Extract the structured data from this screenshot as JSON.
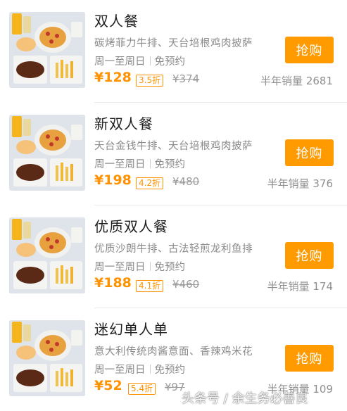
{
  "deals": [
    {
      "title": "双人餐",
      "desc": "碳烤菲力牛排、天台培根鸡肉披萨",
      "days": "周一至周日",
      "booking": "免预约",
      "price": "¥128",
      "discount": "3.5折",
      "original": "¥374",
      "sales": "半年销量 2681",
      "button": "抢购"
    },
    {
      "title": "新双人餐",
      "desc": "天台金钱牛排、天台培根鸡肉披萨",
      "days": "周一至周日",
      "booking": "免预约",
      "price": "¥198",
      "discount": "4.2折",
      "original": "¥480",
      "sales": "半年销量 376",
      "button": "抢购"
    },
    {
      "title": "优质双人餐",
      "desc": "优质沙朗牛排、古法轻煎龙利鱼排",
      "days": "周一至周日",
      "booking": "免预约",
      "price": "¥188",
      "discount": "4.1折",
      "original": "¥460",
      "sales": "半年销量 174",
      "button": "抢购"
    },
    {
      "title": "迷幻单人单",
      "desc": "意大利传统肉酱意面、香辣鸡米花",
      "days": "周一至周日",
      "booking": "免预约",
      "price": "¥52",
      "discount": "5.4折",
      "original": "¥97",
      "sales": "半年销量 109",
      "button": "抢购"
    }
  ],
  "watermark": "头条号 / 余生务必善良",
  "colors": {
    "accent": "#ff9a00",
    "price": "#ff9200",
    "muted": "#8a8a8a"
  },
  "icons": [
    "meal-photo"
  ]
}
